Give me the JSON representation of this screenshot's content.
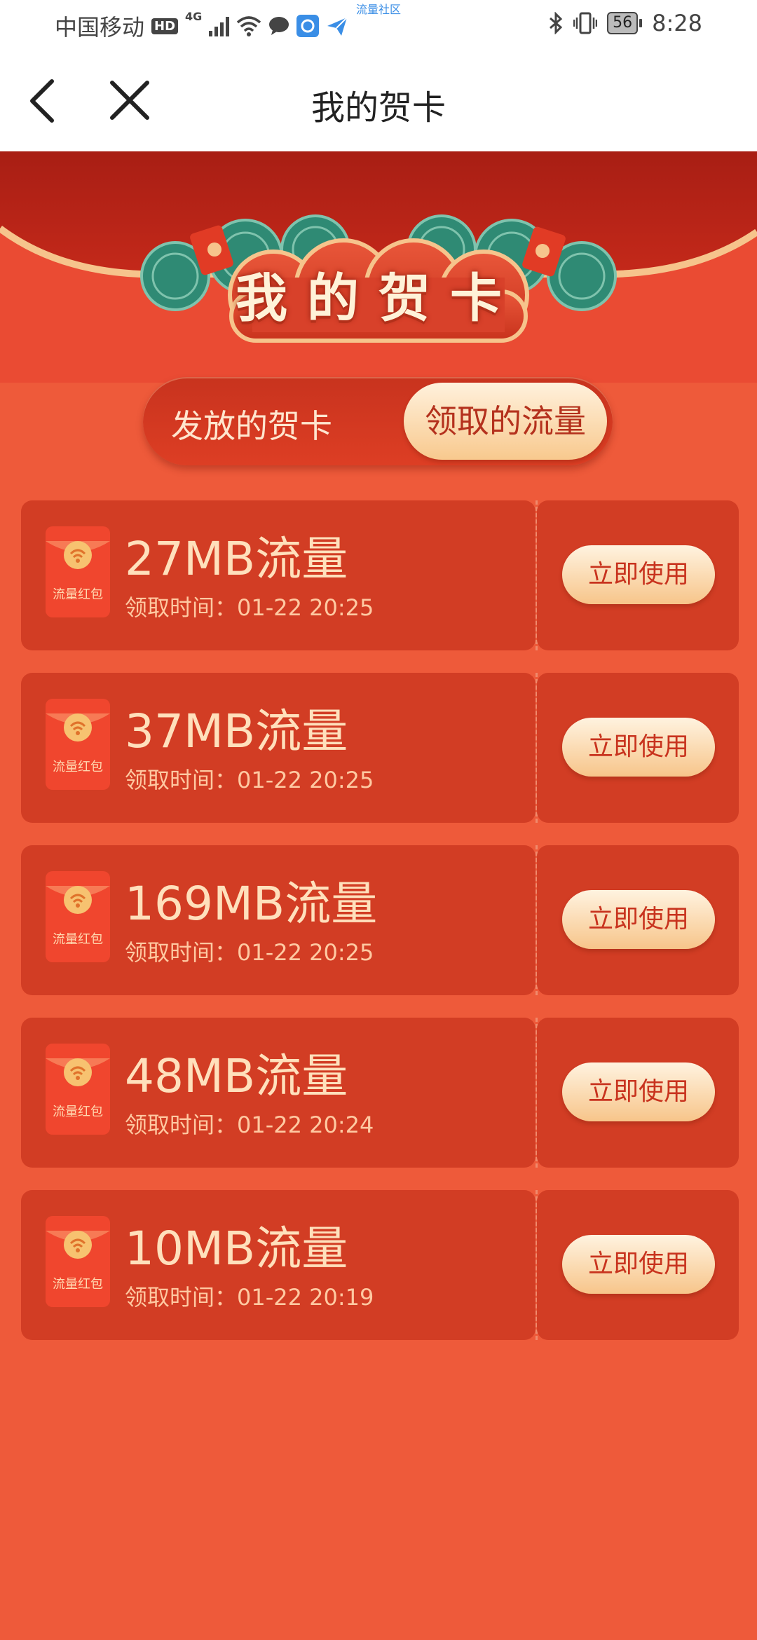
{
  "status_bar": {
    "carrier": "中国移动",
    "hd_badge": "HD",
    "network": "4G",
    "mini_label": "流量社区",
    "battery": "56",
    "time": "8:28"
  },
  "navbar": {
    "title": "我的贺卡"
  },
  "banner": {
    "title": "我的贺卡"
  },
  "tabs": {
    "issued": "发放的贺卡",
    "received": "领取的流量"
  },
  "cards": [
    {
      "envelope_label": "流量红包",
      "amount": "27MB流量",
      "time": "领取时间：01-22 20:25",
      "button": "立即使用"
    },
    {
      "envelope_label": "流量红包",
      "amount": "37MB流量",
      "time": "领取时间：01-22 20:25",
      "button": "立即使用"
    },
    {
      "envelope_label": "流量红包",
      "amount": "169MB流量",
      "time": "领取时间：01-22 20:25",
      "button": "立即使用"
    },
    {
      "envelope_label": "流量红包",
      "amount": "48MB流量",
      "time": "领取时间：01-22 20:24",
      "button": "立即使用"
    },
    {
      "envelope_label": "流量红包",
      "amount": "10MB流量",
      "time": "领取时间：01-22 20:19",
      "button": "立即使用"
    }
  ],
  "colors": {
    "page_background": "#ee5a3a",
    "card_background": "#d23d24",
    "button_text": "#c8331e",
    "accent_gold": "#f7c58a"
  },
  "icons": [
    "back-icon",
    "close-icon",
    "wifi-icon",
    "bluetooth-icon",
    "vibrate-icon",
    "signal-icon",
    "chat-icon"
  ]
}
